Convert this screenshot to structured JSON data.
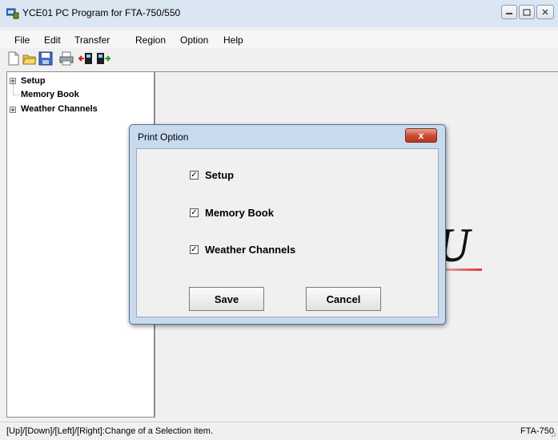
{
  "window": {
    "title": "YCE01 PC Program for FTA-750/550"
  },
  "menu": [
    "File",
    "Edit",
    "Transfer",
    "Region",
    "Option",
    "Help"
  ],
  "toolbar": {
    "icons": [
      "new-file-icon",
      "open-folder-icon",
      "save-icon",
      "print-icon",
      "read-from-radio-icon",
      "write-to-radio-icon"
    ]
  },
  "tree": {
    "items": [
      {
        "label": "Setup",
        "expandable": true
      },
      {
        "label": "Memory Book",
        "expandable": false
      },
      {
        "label": "Weather Channels",
        "expandable": true
      }
    ]
  },
  "dialog": {
    "title": "Print Option",
    "close_label": "x",
    "options": [
      {
        "label": "Setup",
        "checked": true
      },
      {
        "label": "Memory Book",
        "checked": true
      },
      {
        "label": "Weather Channels",
        "checked": true
      }
    ],
    "save_label": "Save",
    "cancel_label": "Cancel"
  },
  "status": {
    "text": "[Up]/[Down]/[Left]/[Right]:Change of a Selection item.",
    "model": "FTA-750"
  },
  "colors": {
    "titlebar": "#dbe6f3",
    "dialog_frame": "#c8daee",
    "close_button": "#c74a32"
  }
}
